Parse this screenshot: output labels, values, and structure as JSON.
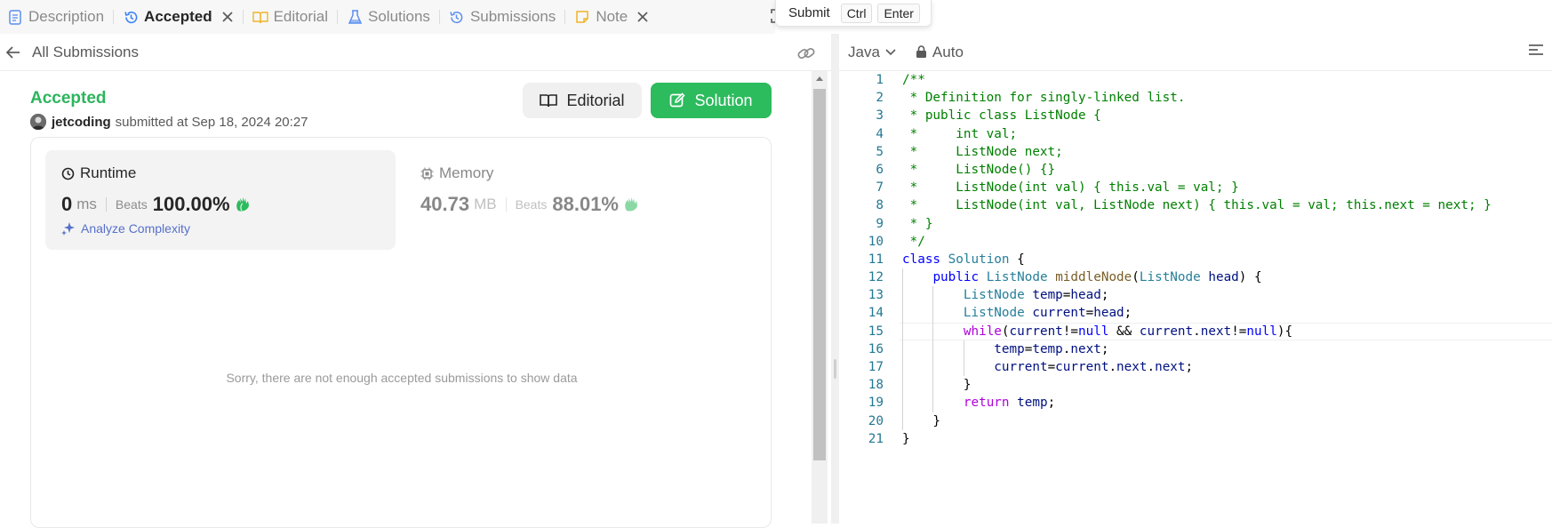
{
  "tabs": [
    {
      "label": "Description",
      "icon": "description-icon",
      "active": false
    },
    {
      "label": "Accepted",
      "icon": "history-icon",
      "active": true,
      "closable": true
    },
    {
      "label": "Editorial",
      "icon": "book-icon",
      "active": false
    },
    {
      "label": "Solutions",
      "icon": "flask-icon",
      "active": false
    },
    {
      "label": "Submissions",
      "icon": "history-icon",
      "active": false
    },
    {
      "label": "Note",
      "icon": "note-icon",
      "active": false,
      "closable": true
    }
  ],
  "tooltip": {
    "label": "Submit",
    "keys": [
      "Ctrl",
      "Enter"
    ]
  },
  "submission": {
    "back_label": "All Submissions",
    "status": "Accepted",
    "user": "jetcoding",
    "submitted_text": "submitted at Sep 18, 2024 20:27",
    "editorial_button": "Editorial",
    "solution_button": "Solution",
    "runtime": {
      "label": "Runtime",
      "value": "0",
      "unit": "ms",
      "beats_label": "Beats",
      "beats": "100.00%"
    },
    "memory": {
      "label": "Memory",
      "value": "40.73",
      "unit": "MB",
      "beats_label": "Beats",
      "beats": "88.01%"
    },
    "analyze_label": "Analyze Complexity",
    "empty_message": "Sorry, there are not enough accepted submissions to show data"
  },
  "editor": {
    "language": "Java",
    "mode": "Auto",
    "current_line": 15,
    "lines": [
      "/**",
      " * Definition for singly-linked list.",
      " * public class ListNode {",
      " *     int val;",
      " *     ListNode next;",
      " *     ListNode() {}",
      " *     ListNode(int val) { this.val = val; }",
      " *     ListNode(int val, ListNode next) { this.val = val; this.next = next; }",
      " * }",
      " */",
      "class Solution {",
      "    public ListNode middleNode(ListNode head) {",
      "        ListNode temp=head;",
      "        ListNode current=head;",
      "        while(current!=null && current.next!=null){",
      "            temp=temp.next;",
      "            current=current.next.next;",
      "        }",
      "        return temp;",
      "    }",
      "}"
    ]
  },
  "colors": {
    "accent_green": "#2cbb5d",
    "accepted_text": "#2cb55d",
    "analyze_blue": "#5670c8"
  }
}
